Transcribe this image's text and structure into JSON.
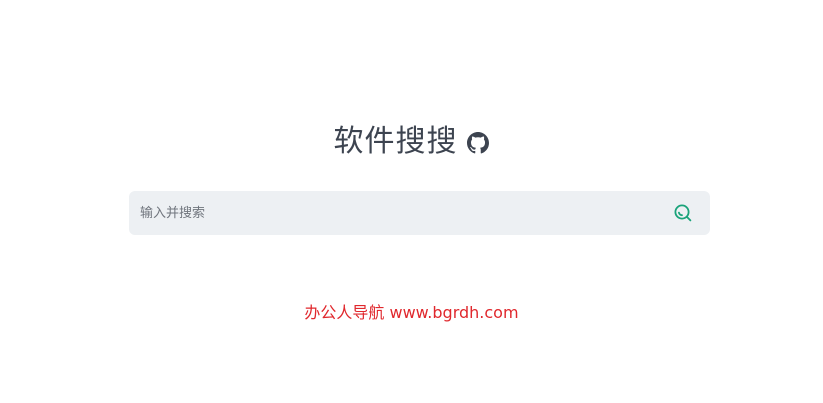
{
  "header": {
    "title": "软件搜搜",
    "repo_icon": "github-icon"
  },
  "search": {
    "placeholder": "输入并搜索",
    "value": "",
    "button_icon": "search-icon",
    "accent_color": "#1aa37a"
  },
  "footer": {
    "link_text": "办公人导航 www.bgrdh.com",
    "color": "#e0282d"
  }
}
